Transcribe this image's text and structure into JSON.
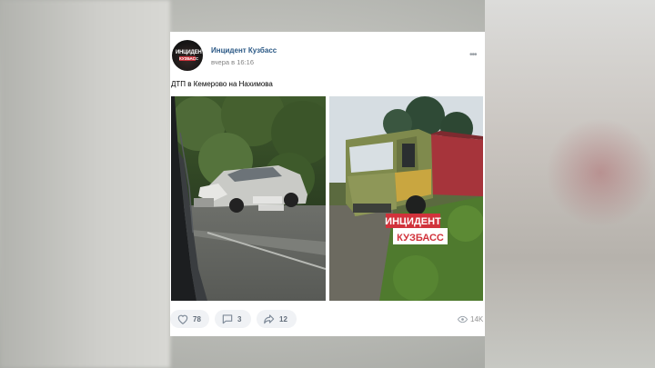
{
  "post": {
    "author": "Инцидент Кузбасс",
    "time": "вчера в 16:16",
    "text": "ДТП в Кемерово на Нахимова",
    "avatar": {
      "line1": "ИНЦИДЕНТ",
      "line2": "КУЗБАСС"
    }
  },
  "photos": {
    "photo2_watermark": {
      "line1": "ИНЦИДЕНТ",
      "line2": "КУЗБАСС"
    }
  },
  "actions": {
    "likes": "78",
    "comments": "3",
    "shares": "12",
    "views": "14K"
  },
  "colors": {
    "author_link": "#2a5885",
    "action_bg": "#f0f2f5",
    "watermark_red": "#c8323a"
  }
}
